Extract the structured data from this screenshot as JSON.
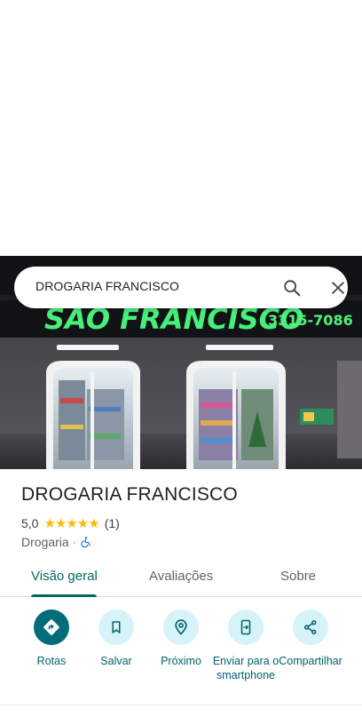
{
  "search": {
    "query": "DROGARIA FRANCISCO"
  },
  "photo": {
    "sign_text": "SAO FRANCISCO",
    "phone_text": "3315-7086"
  },
  "place": {
    "title": "DROGARIA FRANCISCO",
    "rating": "5,0",
    "stars": "★★★★★",
    "review_count": "(1)",
    "category": "Drogaria",
    "separator": "·"
  },
  "tabs": [
    {
      "label": "Visão geral",
      "active": true
    },
    {
      "label": "Avaliações",
      "active": false
    },
    {
      "label": "Sobre",
      "active": false
    }
  ],
  "actions": [
    {
      "label": "Rotas",
      "icon": "directions-icon"
    },
    {
      "label": "Salvar",
      "icon": "bookmark-icon"
    },
    {
      "label": "Próximo",
      "icon": "nearby-icon"
    },
    {
      "label": "Enviar para o smartphone",
      "icon": "send-to-phone-icon"
    },
    {
      "label": "Compartilhar",
      "icon": "share-icon"
    }
  ],
  "colors": {
    "accent": "#00695f",
    "action_bg": "#d6f3f9",
    "primary_action_bg": "#016d79",
    "star": "#fbbc04"
  }
}
